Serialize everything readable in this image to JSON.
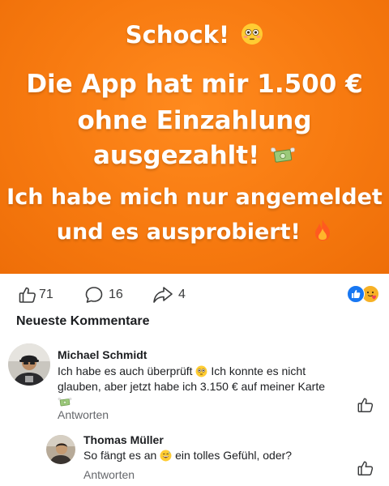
{
  "banner": {
    "line1": "Schock!",
    "line2": "Die App hat mir 1.500 €",
    "line3": "ohne Einzahlung",
    "line4": "ausgezahlt!",
    "line5": "Ich habe mich nur angemeldet",
    "line6": "und es ausprobiert!",
    "colors": {
      "background": "#f77a10",
      "text": "#ffffff"
    }
  },
  "reactions": {
    "likes": "71",
    "comments": "16",
    "shares": "4",
    "reaction_icons": [
      "like-reaction-icon",
      "care-reaction-icon"
    ]
  },
  "comments_section": {
    "title": "Neueste Kommentare",
    "comments": [
      {
        "author": "Michael Schmidt",
        "text_part1": "Ich habe es auch überprüft",
        "text_part2": "Ich konnte es nicht glauben, aber jetzt habe ich 3.150 € auf meiner Karte",
        "reply_label": "Antworten"
      },
      {
        "author": "Thomas Müller",
        "text_part1": "So fängt es an",
        "text_part2": "ein tolles Gefühl, oder?",
        "reply_label": "Antworten"
      }
    ]
  },
  "colors": {
    "accent_blue": "#1877f2",
    "secondary_text": "#65676b"
  }
}
